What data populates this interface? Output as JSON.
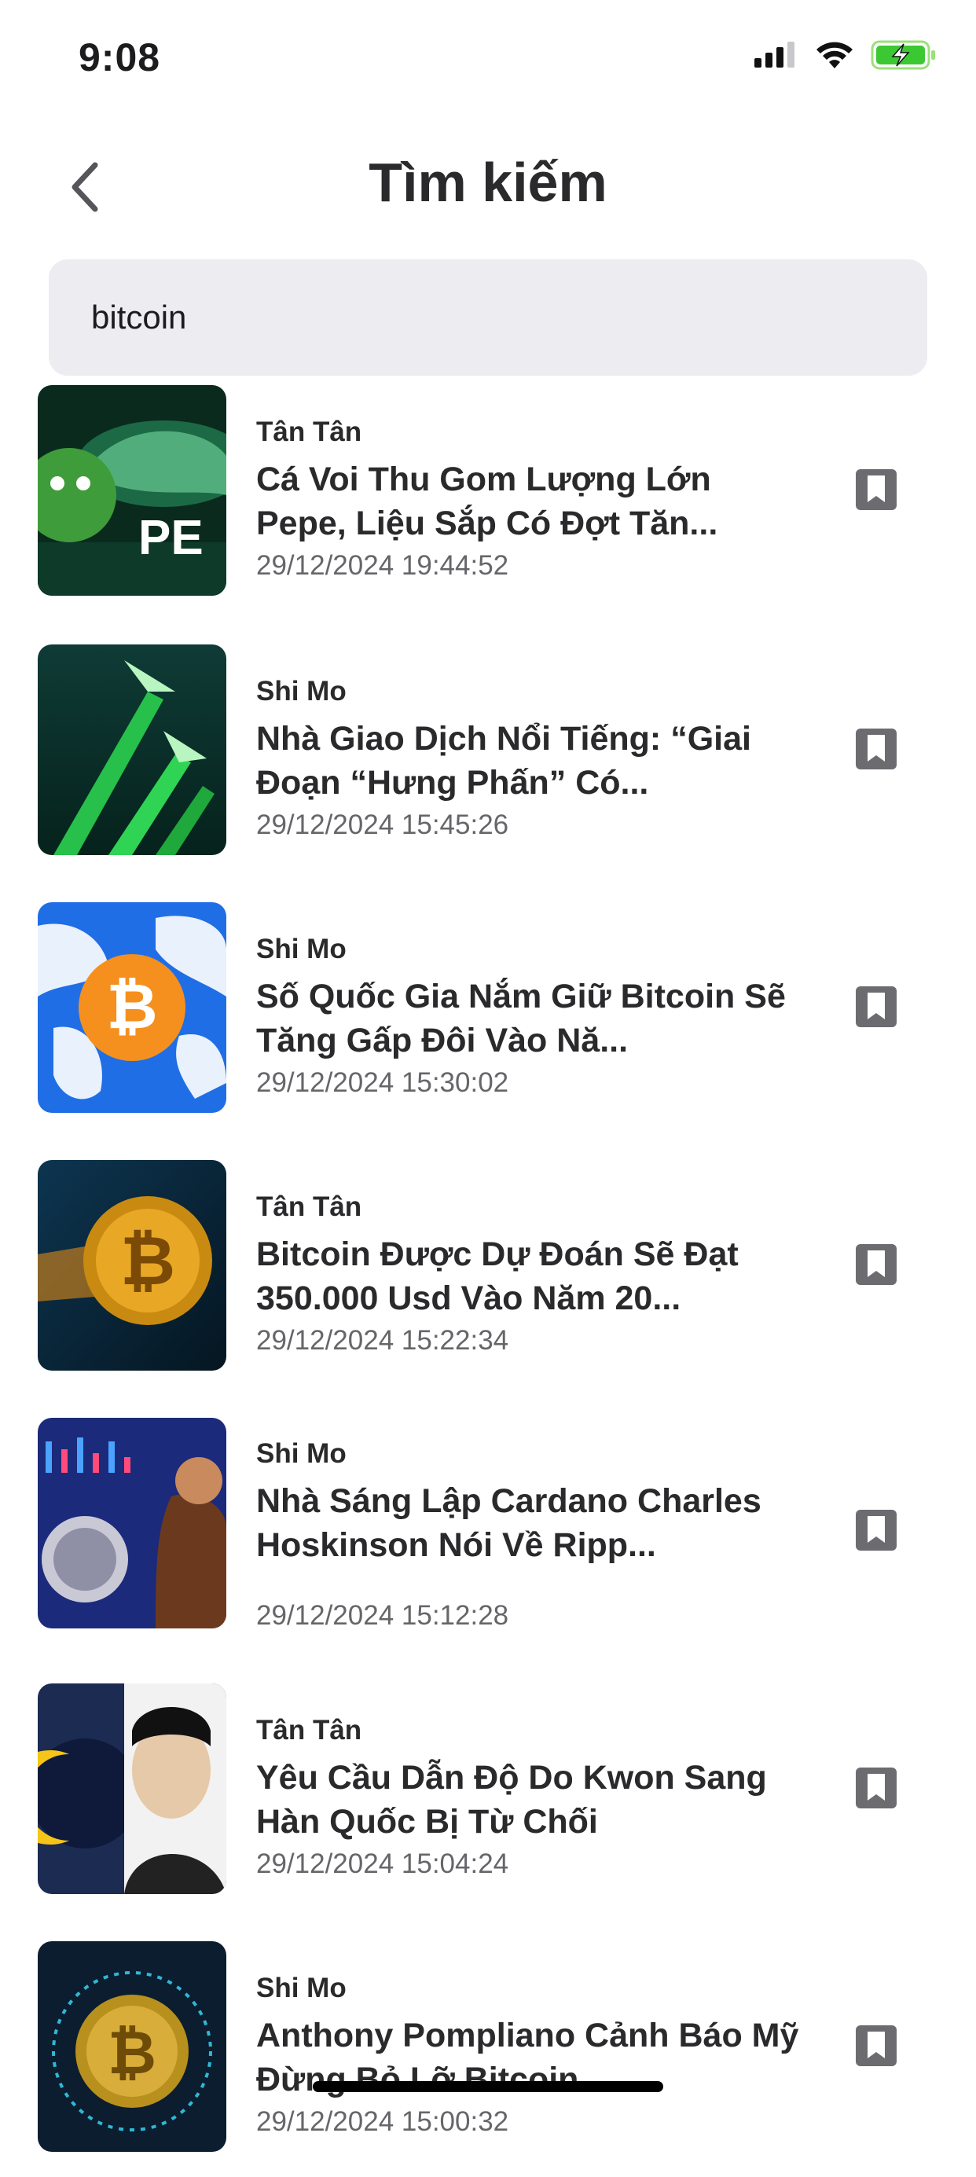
{
  "status_bar": {
    "time": "9:08"
  },
  "header": {
    "title": "Tìm kiếm"
  },
  "search": {
    "value": "bitcoin"
  },
  "articles": [
    {
      "author": "Tân Tân",
      "title": "Cá Voi Thu Gom Lượng Lớn Pepe, Liệu Sắp Có Đợt Tăn...",
      "date": "29/12/2024 19:44:52",
      "thumb_text": "PE"
    },
    {
      "author": "Shi Mo",
      "title": "Nhà Giao Dịch Nổi Tiếng: “Giai Đoạn “Hưng Phấn” Có...",
      "date": "29/12/2024 15:45:26"
    },
    {
      "author": "Shi Mo",
      "title": "Số Quốc Gia Nắm Giữ Bitcoin Sẽ Tăng Gấp Đôi Vào Nă...",
      "date": "29/12/2024 15:30:02"
    },
    {
      "author": "Tân Tân",
      "title": "Bitcoin Được Dự Đoán Sẽ Đạt 350.000 Usd Vào Năm 20...",
      "date": "29/12/2024 15:22:34"
    },
    {
      "author": "Shi Mo",
      "title": "Nhà Sáng Lập Cardano Charles Hoskinson Nói Về Ripp...",
      "date": "29/12/2024 15:12:28"
    },
    {
      "author": "Tân Tân",
      "title": "Yêu Cầu Dẫn Độ Do Kwon Sang Hàn Quốc Bị Từ Chối",
      "date": "29/12/2024 15:04:24"
    },
    {
      "author": "Shi Mo",
      "title": "Anthony Pompliano Cảnh Báo Mỹ Đừng Bỏ Lỡ Bitcoin",
      "date": "29/12/2024 15:00:32"
    }
  ]
}
